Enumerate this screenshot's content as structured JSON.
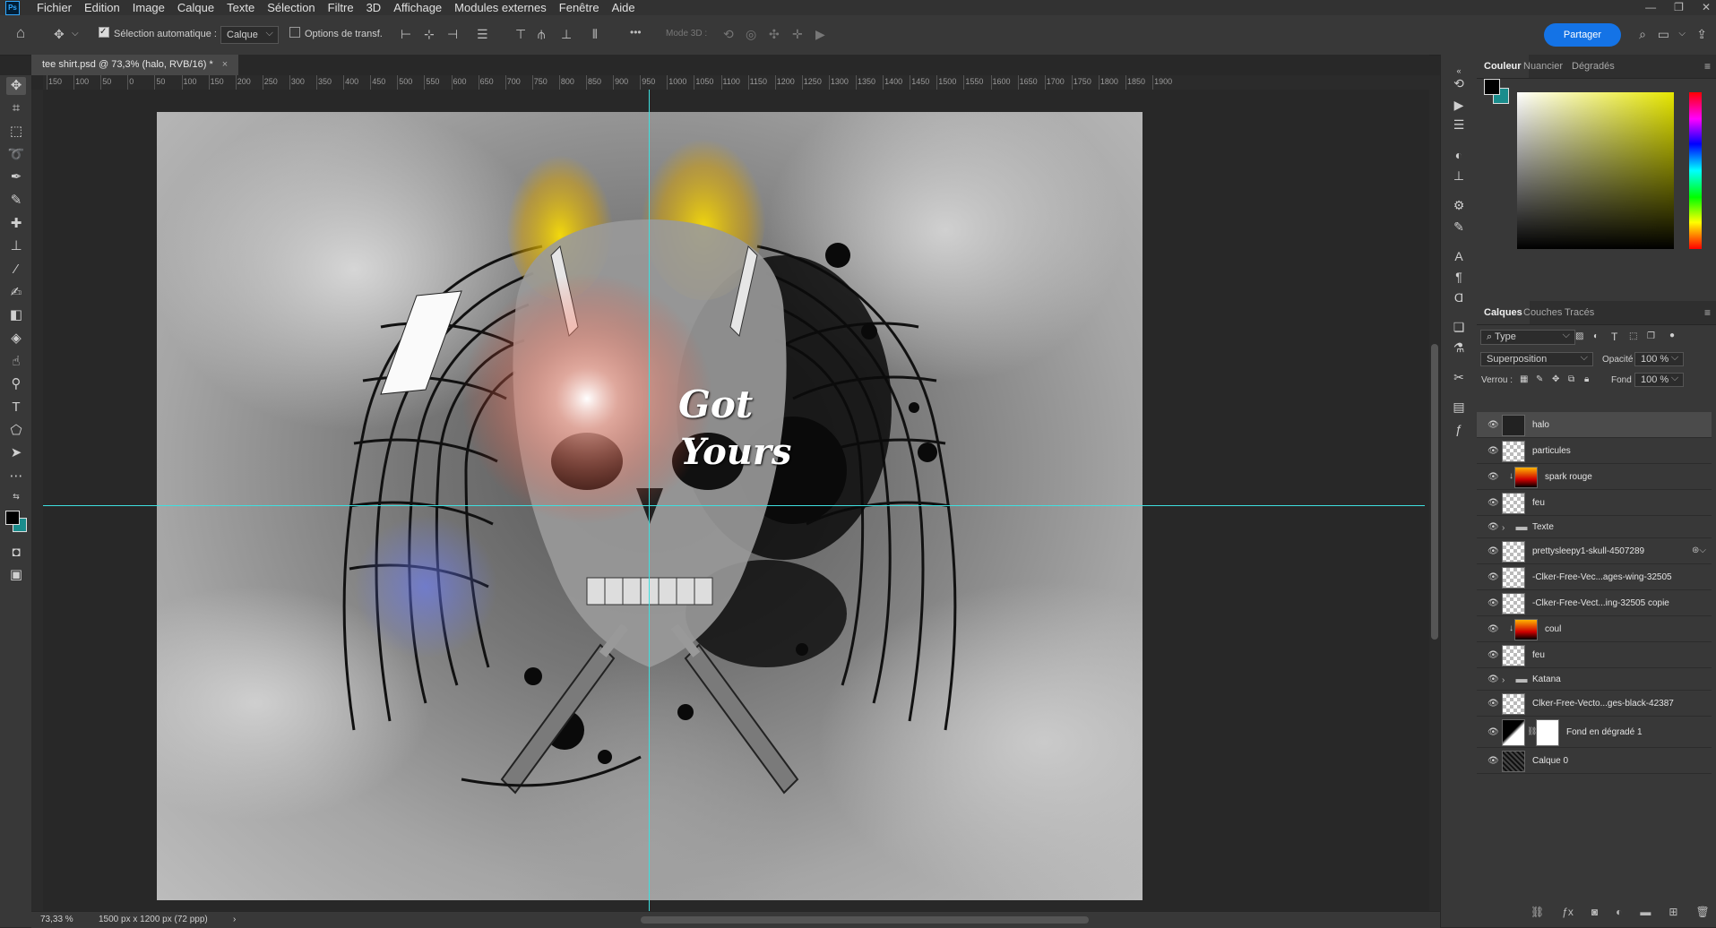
{
  "app": {
    "logo": "Ps"
  },
  "menu": [
    "Fichier",
    "Edition",
    "Image",
    "Calque",
    "Texte",
    "Sélection",
    "Filtre",
    "3D",
    "Affichage",
    "Modules externes",
    "Fenêtre",
    "Aide"
  ],
  "window_controls": [
    "—",
    "❐",
    "✕"
  ],
  "options": {
    "auto_select_label": "Sélection automatique :",
    "auto_select_target": "Calque",
    "transform_options_label": "Options de transf.",
    "mode_3d_label": "Mode 3D :",
    "more": "•••",
    "share_label": "Partager"
  },
  "tab": {
    "title": "tee shirt.psd @ 73,3% (halo, RVB/16) *",
    "close": "×"
  },
  "ruler_top": [
    "150",
    "100",
    "50",
    "0",
    "50",
    "100",
    "150",
    "200",
    "250",
    "300",
    "350",
    "400",
    "450",
    "500",
    "550",
    "600",
    "650",
    "700",
    "750",
    "800",
    "850",
    "900",
    "950",
    "1000",
    "1050",
    "1100",
    "1150",
    "1200",
    "1250",
    "1300",
    "1350",
    "1400",
    "1450",
    "1500",
    "1550",
    "1600",
    "1650",
    "1700",
    "1750",
    "1800",
    "1850",
    "1900"
  ],
  "artwork": {
    "word_1": "Got",
    "word_2": "Yours"
  },
  "status": {
    "zoom": "73,33 %",
    "doc_size": "1500 px x 1200 px (72 ppp)",
    "arrow": "›"
  },
  "color_panel": {
    "tabs": [
      "Couleur",
      "Nuancier",
      "Dégradés"
    ],
    "fg": "#000000",
    "bg": "#1a8c8c"
  },
  "layers_panel": {
    "tabs": [
      "Calques",
      "Couches",
      "Tracés"
    ],
    "filter": "Type",
    "blend_mode": "Superposition",
    "opacity_label": "Opacité :",
    "opacity_value": "100 %",
    "lock_label": "Verrou :",
    "fill_label": "Fond :",
    "fill_value": "100 %",
    "layers": [
      {
        "name": "halo",
        "thumb": "dark",
        "selected": true
      },
      {
        "name": "particules",
        "thumb": "checker"
      },
      {
        "name": "spark rouge",
        "thumb": "grad",
        "clipped": true
      },
      {
        "name": "feu",
        "thumb": "checker"
      },
      {
        "name": "Texte",
        "thumb": "folder",
        "group": true
      },
      {
        "name": "prettysleepy1-skull-4507289",
        "thumb": "checker"
      },
      {
        "name": "-Clker-Free-Vec...ages-wing-32505",
        "thumb": "checker"
      },
      {
        "name": "-Clker-Free-Vect...ing-32505 copie",
        "thumb": "checker"
      },
      {
        "name": "coul",
        "thumb": "grad",
        "clipped": true
      },
      {
        "name": "feu",
        "thumb": "checker"
      },
      {
        "name": "Katana",
        "thumb": "folder",
        "group": true
      },
      {
        "name": "Clker-Free-Vecto...ges-black-42387",
        "thumb": "checker"
      },
      {
        "name": "Fond en dégradé 1",
        "thumb": "wb",
        "mask": true
      },
      {
        "name": "Calque 0",
        "thumb": "noise"
      }
    ]
  }
}
